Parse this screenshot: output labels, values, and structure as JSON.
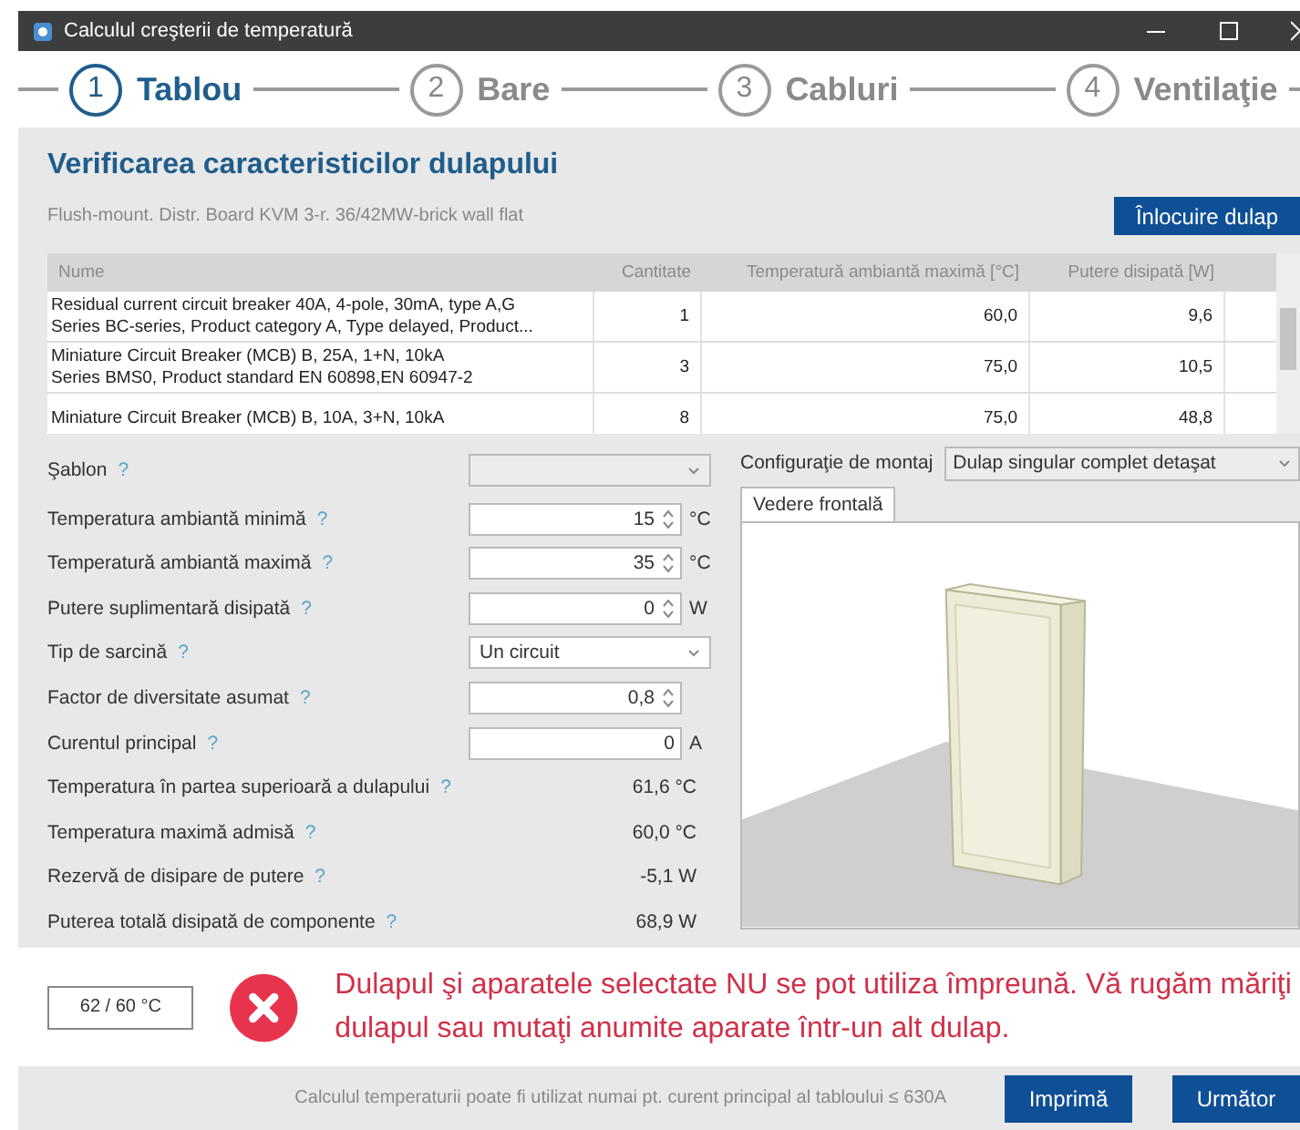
{
  "window": {
    "title": "Calculul creşterii de temperatură"
  },
  "steps": [
    {
      "number": "1",
      "label": "Tablou",
      "selected": true
    },
    {
      "number": "2",
      "label": "Bare",
      "selected": false
    },
    {
      "number": "3",
      "label": "Cabluri",
      "selected": false
    },
    {
      "number": "4",
      "label": "Ventilaţie",
      "selected": false
    }
  ],
  "header": {
    "title": "Verificarea caracteristicilor dulapului",
    "subtitle": "Flush-mount. Distr. Board KVM 3-r. 36/42MW-brick wall flat",
    "button": "Înlocuire dulap"
  },
  "table": {
    "columns": [
      "Nume",
      "Cantitate",
      "Temperatură ambiantă maximă [°C]",
      "Putere disipată [W]"
    ],
    "rows": [
      {
        "name": "Residual current circuit breaker 40A, 4-pole, 30mA, type A,G\nSeries BC-series, Product category A, Type delayed, Product...",
        "quantity": "1",
        "max_temp": "60,0",
        "power": "9,6"
      },
      {
        "name": "Miniature Circuit Breaker (MCB) B, 25A, 1+N, 10kA\nSeries BMS0, Product standard EN 60898,EN 60947-2",
        "quantity": "3",
        "max_temp": "75,0",
        "power": "10,5"
      },
      {
        "name": "Miniature Circuit Breaker (MCB) B, 10A, 3+N, 10kA",
        "quantity": "8",
        "max_temp": "75,0",
        "power": "48,8"
      }
    ]
  },
  "form": [
    {
      "kind": "select",
      "label": "Şablon",
      "help": "?"
    },
    {
      "kind": "spin",
      "label": "Temperatura ambiantă minimă",
      "help": "?",
      "value": "15",
      "unit": "°C"
    },
    {
      "kind": "spin",
      "label": "Temperatură ambiantă maximă",
      "help": "?",
      "value": "35",
      "unit": "°C"
    },
    {
      "kind": "spin",
      "label": "Putere suplimentară disipată",
      "help": "?",
      "value": "0",
      "unit": "W"
    },
    {
      "kind": "select",
      "label": "Tip de sarcină",
      "help": "?",
      "value": "Un circuit"
    },
    {
      "kind": "spin",
      "label": "Factor de diversitate asumat",
      "help": "?",
      "value": "0,8"
    },
    {
      "kind": "input",
      "label": "Curentul principal",
      "help": "?",
      "value": "0",
      "unit": "A"
    },
    {
      "kind": "readout",
      "label": "Temperatura în partea superioară a dulapului",
      "help": "?",
      "value": "61,6 °C"
    },
    {
      "kind": "readout",
      "label": "Temperatura maximă admisă",
      "help": "?",
      "value": "60,0 °C"
    },
    {
      "kind": "readout",
      "label": "Rezervă de disipare de putere",
      "help": "?",
      "value": "-5,1 W"
    },
    {
      "kind": "readout",
      "label": "Puterea totală disipată de componente",
      "help": "?",
      "value": "68,9 W"
    }
  ],
  "mounting": {
    "label": "Configuraţie de montaj",
    "value": "Dulap singular complet detaşat"
  },
  "view_tabs": [
    {
      "label": "Vedere frontală",
      "selected": true
    }
  ],
  "result": {
    "reading": "62 / 60 °C",
    "message": "Dulapul şi aparatele selectate NU se pot utiliza împreună. Vă rugăm măriţi dulapul sau mutaţi anumite aparate într-un alt dulap."
  },
  "footer": {
    "note": "Calculul temperaturii poate fi utilizat numai pt. curent principal al tabloului ≤ 630A",
    "buttons": [
      "Imprimă",
      "Următor"
    ]
  }
}
